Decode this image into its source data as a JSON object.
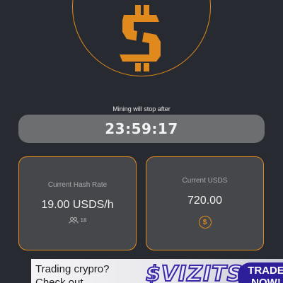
{
  "theme": {
    "background": "#272a31",
    "accent": "#e08a1e",
    "card_background": "#46474b",
    "timer_background": "#6d6e70"
  },
  "logo": {
    "icon": "dollar-icon"
  },
  "timer": {
    "label": "Mining will stop after",
    "value": "23:59:17"
  },
  "cards": {
    "hash_rate": {
      "title": "Current Hash Rate",
      "value": "19.00 USDS/h",
      "peers_icon": "users-icon",
      "peers_count": "18"
    },
    "balance": {
      "title": "Current USDS",
      "value": "720.00",
      "icon": "coin-icon",
      "icon_glyph": "$"
    }
  },
  "ad": {
    "line1": "Trading crypro?",
    "line2": "Check out",
    "brand": "$VIZITS",
    "button": "TRADE NOW!"
  }
}
